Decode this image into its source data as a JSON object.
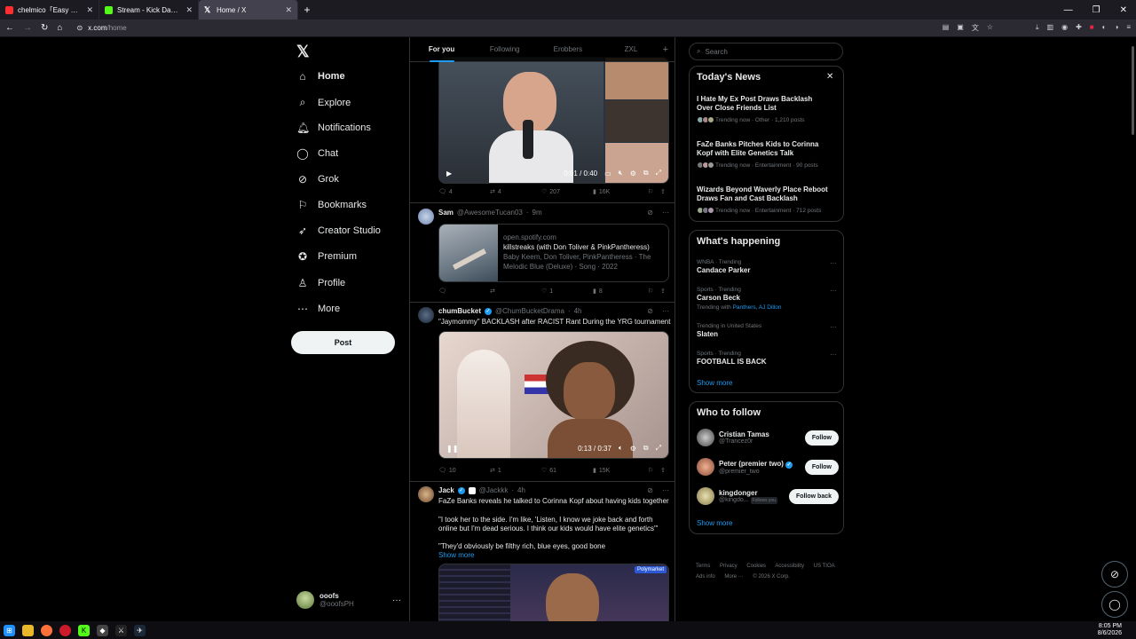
{
  "browser": {
    "tabs": [
      {
        "label": "chelmico「Easy Breezy」【Offi",
        "color": "#ff2d2d",
        "active": false
      },
      {
        "label": "Stream - Kick Dashboard",
        "color": "#53fc18",
        "active": false
      },
      {
        "label": "Home / X",
        "color": "#e7e9ea",
        "active": true
      }
    ],
    "url_host": "x.com",
    "url_path": "/home"
  },
  "leftnav": {
    "items": [
      {
        "label": "Home",
        "icon": "home-icon"
      },
      {
        "label": "Explore",
        "icon": "search-icon"
      },
      {
        "label": "Notifications",
        "icon": "bell-icon"
      },
      {
        "label": "Chat",
        "icon": "chat-icon"
      },
      {
        "label": "Grok",
        "icon": "grok-icon"
      },
      {
        "label": "Bookmarks",
        "icon": "bookmark-icon"
      },
      {
        "label": "Creator Studio",
        "icon": "rocket-icon"
      },
      {
        "label": "Premium",
        "icon": "premium-icon"
      },
      {
        "label": "Profile",
        "icon": "person-icon"
      },
      {
        "label": "More",
        "icon": "more-circle-icon"
      }
    ],
    "post_label": "Post",
    "account": {
      "name": "ooofs",
      "handle": "@ooofsPH"
    }
  },
  "feed": {
    "tabs": [
      "For you",
      "Following",
      "Erobbers",
      "ZXL"
    ],
    "post1": {
      "time": "0:01 / 0:40",
      "reply": "4",
      "retweet": "4",
      "like": "207",
      "views": "16K"
    },
    "post2": {
      "name": "Sam",
      "handle": "@AwesomeTucan03",
      "age": "9m",
      "card_domain": "open.spotify.com",
      "card_title": "killstreaks (with Don Toliver & PinkPantheress)",
      "card_desc": "Baby Keem, Don Toliver, PinkPantheress · The Melodic Blue (Deluxe) · Song · 2022",
      "like": "1",
      "views": "8"
    },
    "post3": {
      "name": "chumBucket",
      "handle": "@ChumBucketDrama",
      "age": "4h",
      "text": "\"Jaymommy\" BACKLASH after RACIST Rant During the YRG tournament",
      "time": "0:13 / 0:37",
      "reply": "10",
      "retweet": "1",
      "like": "61",
      "views": "15K"
    },
    "post4": {
      "name": "Jack",
      "handle": "@Jackkk",
      "age": "4h",
      "line1": "FaZe Banks reveals he talked to Corinna Kopf about having kids together",
      "line2": "\"I took her to the side. I'm like, 'Listen, I know we joke back and forth online but I'm dead serious. I think our kids would have elite genetics'\"",
      "line3": "\"They'd obviously be filthy rich, blue eyes, good bone",
      "show_more": "Show more",
      "media_badge": "Polymarket"
    }
  },
  "right": {
    "search_placeholder": "Search",
    "news": {
      "title": "Today's News",
      "items": [
        {
          "headline": "I Hate My Ex Post Draws Backlash Over Close Friends List",
          "meta": "Trending now · Other · 1,210 posts"
        },
        {
          "headline": "FaZe Banks Pitches Kids to Corinna Kopf with Elite Genetics Talk",
          "meta": "Trending now · Entertainment · 90 posts"
        },
        {
          "headline": "Wizards Beyond Waverly Place Reboot Draws Fan and Cast Backlash",
          "meta": "Trending now · Entertainment · 712 posts"
        }
      ]
    },
    "happening": {
      "title": "What's happening",
      "items": [
        {
          "meta": "WNBA · Trending",
          "topic": "Candace Parker",
          "extra_prefix": "",
          "extra_links": ""
        },
        {
          "meta": "Sports · Trending",
          "topic": "Carson Beck",
          "extra_prefix": "Trending with",
          "extra_links": "Panthers, AJ Dillon"
        },
        {
          "meta": "Trending in United States",
          "topic": "Slaten",
          "extra_prefix": "",
          "extra_links": ""
        },
        {
          "meta": "Sports · Trending",
          "topic": "FOOTBALL IS BACK",
          "extra_prefix": "",
          "extra_links": ""
        }
      ],
      "show_more": "Show more"
    },
    "follow": {
      "title": "Who to follow",
      "items": [
        {
          "name": "Cristian Tamas",
          "handle": "@Trancez0r",
          "button": "Follow",
          "badge": ""
        },
        {
          "name": "Peter (premier two)",
          "handle": "@premier_two",
          "button": "Follow",
          "badge": ""
        },
        {
          "name": "kingdonger",
          "handle": "@kingdo...",
          "button": "Follow back",
          "badge": "Follows you"
        }
      ],
      "show_more": "Show more"
    },
    "footer": {
      "line1": [
        "Terms",
        "Privacy",
        "Cookies",
        "Accessibility",
        "US TIOA"
      ],
      "line2": [
        "Ads info",
        "More ···",
        "© 2026 X Corp."
      ]
    }
  },
  "taskbar": {
    "time": "8:05 PM",
    "date": "8/6/2026"
  }
}
